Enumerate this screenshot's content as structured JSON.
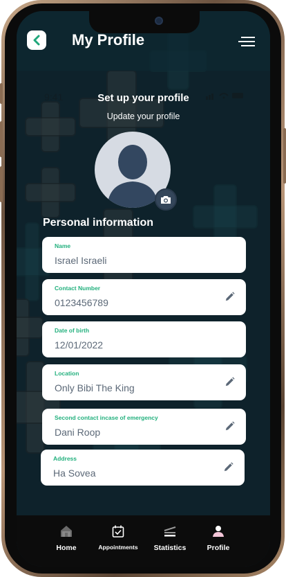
{
  "header": {
    "title": "My Profile"
  },
  "ghost_status": {
    "time": "9:41"
  },
  "profile": {
    "setup_title": "Set up your profile",
    "setup_subtitle": "Update your profile",
    "section_title": "Personal information"
  },
  "fields": [
    {
      "label": "Name",
      "value": "Israel Israeli",
      "editable": false
    },
    {
      "label": "Contact Number",
      "value": "0123456789",
      "editable": true
    },
    {
      "label": "Date of birth",
      "value": "12/01/2022",
      "editable": false
    },
    {
      "label": "Location",
      "value": "Only Bibi The King",
      "editable": true
    },
    {
      "label": "Second contact incase of emergency",
      "value": "Dani Roop",
      "editable": true
    },
    {
      "label": "Address",
      "value": "Ha Sovea",
      "editable": true
    }
  ],
  "nav": [
    {
      "label": "Home",
      "icon": "home-icon"
    },
    {
      "label": "Appointments",
      "icon": "calendar-check-icon"
    },
    {
      "label": "Statistics",
      "icon": "statistics-icon"
    },
    {
      "label": "Profile",
      "icon": "person-icon"
    }
  ],
  "colors": {
    "accent_green": "#22b07d",
    "back_button_arrow": "#1fa67a",
    "screen_background": "#142c36",
    "field_text": "#5b6877",
    "profile_icon_pink": "#f4c6d9"
  }
}
